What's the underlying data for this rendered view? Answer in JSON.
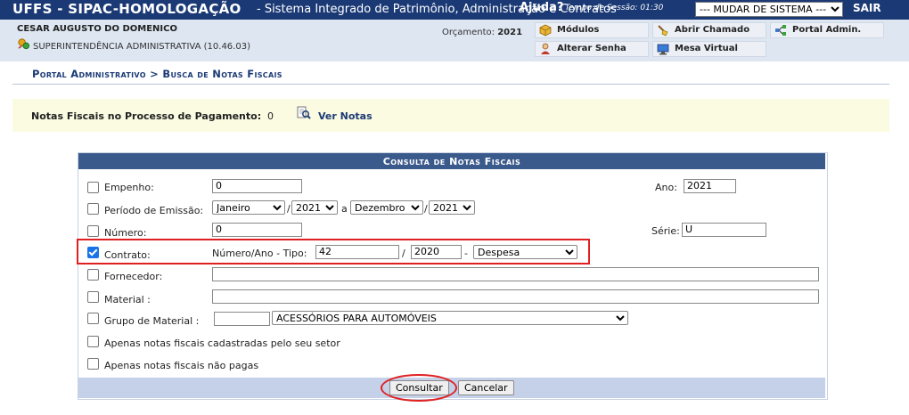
{
  "header": {
    "app_title": "UFFS - SIPAC-HOMOLOGAÇÃO",
    "app_subtitle": "- Sistema Integrado de Patrimônio, Administração e Contratos",
    "help": "Ajuda?",
    "session_label": "Tempo de Sessão: 01:30",
    "system_select": "--- MUDAR DE SISTEMA ---",
    "logout": "SAIR"
  },
  "user": {
    "name": "CESAR AUGUSTO DO DOMENICO",
    "unit": "SUPERINTENDÊNCIA ADMINISTRATIVA (10.46.03)",
    "budget_label": "Orçamento:",
    "budget_year": "2021"
  },
  "menu": {
    "modulos": "Módulos",
    "abrir_chamado": "Abrir Chamado",
    "portal_admin": "Portal Admin.",
    "alterar_senha": "Alterar Senha",
    "mesa_virtual": "Mesa Virtual"
  },
  "breadcrumb": "Portal Administrativo > Busca de Notas Fiscais",
  "notice": {
    "text": "Notas Fiscais no Processo de Pagamento:",
    "count": "0",
    "link": "Ver Notas"
  },
  "form": {
    "caption": "Consulta de Notas Fiscais",
    "empenho": {
      "label": "Empenho:",
      "value": "0"
    },
    "ano": {
      "label": "Ano:",
      "value": "2021"
    },
    "periodo": {
      "label": "Período de Emissão:",
      "start_month": "Janeiro",
      "start_year": "2021",
      "connector": "a",
      "end_month": "Dezembro",
      "end_year": "2021",
      "slash": "/"
    },
    "numero": {
      "label": "Número:",
      "value": "0"
    },
    "serie": {
      "label": "Série:",
      "value": "U"
    },
    "contrato": {
      "label": "Contrato:",
      "sublabel": "Número/Ano - Tipo:",
      "numero": "42",
      "slash": "/",
      "ano": "2020",
      "dash": "-",
      "tipo": "Despesa",
      "checked": true
    },
    "fornecedor": {
      "label": "Fornecedor:",
      "value": ""
    },
    "material": {
      "label": "Material :",
      "value": ""
    },
    "grupo": {
      "label": "Grupo de Material :",
      "code": "",
      "selected": "ACESSÓRIOS PARA AUTOMÓVEIS"
    },
    "apenas_setor": "Apenas notas fiscais cadastradas pelo seu setor",
    "apenas_nao_pagas": "Apenas notas fiscais não pagas",
    "consultar": "Consultar",
    "cancelar": "Cancelar"
  },
  "colors": {
    "header_bg": "#1b3a75",
    "infobar_bg": "#dde6f1",
    "caption_bg": "#3a5a8c",
    "footer_bg": "#c5d1e8",
    "notice_bg": "#fbfbe2",
    "highlight": "#e02020",
    "check_accent": "#1a73e8"
  }
}
